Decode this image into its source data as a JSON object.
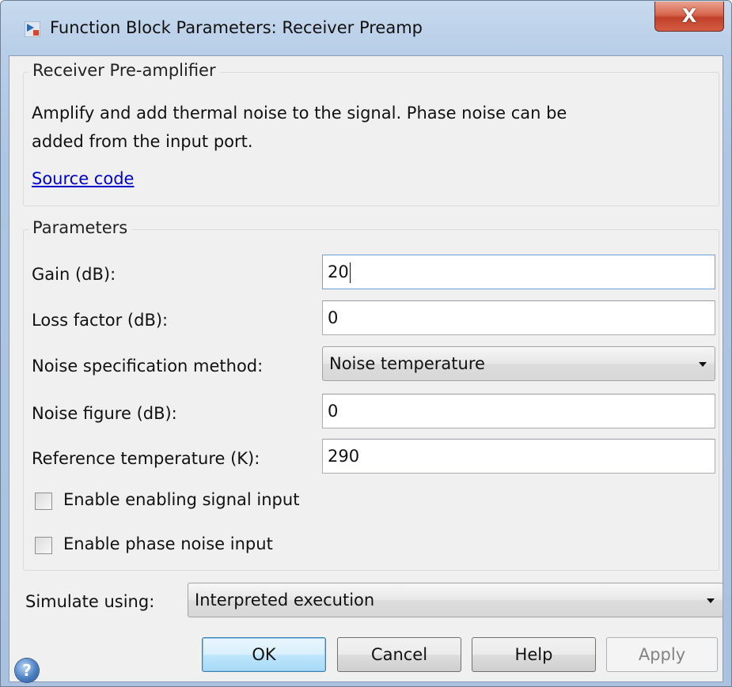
{
  "window": {
    "title": "Function Block Parameters: Receiver Preamp",
    "close_glyph": "X",
    "app_icon": "simulink-block-icon"
  },
  "description_group": {
    "title": "Receiver Pre-amplifier",
    "text_line1": "Amplify and add thermal noise to the signal. Phase noise can be",
    "text_line2": "added from the input port.",
    "link": "Source code"
  },
  "parameters_group": {
    "title": "Parameters",
    "gain": {
      "label": "Gain (dB):",
      "value": "20"
    },
    "loss_factor": {
      "label": "Loss factor (dB):",
      "value": "0"
    },
    "noise_method": {
      "label": "Noise specification method:",
      "value": "Noise temperature"
    },
    "noise_figure": {
      "label": "Noise figure (dB):",
      "value": "0"
    },
    "reference_temperature": {
      "label": "Reference temperature (K):",
      "value": "290"
    },
    "enable_signal_input": {
      "label": "Enable enabling signal input",
      "checked": false
    },
    "enable_phase_noise": {
      "label": "Enable phase noise input",
      "checked": false
    }
  },
  "simulate": {
    "label": "Simulate using:",
    "value": "Interpreted execution"
  },
  "buttons": {
    "help_icon": "?",
    "ok": "OK",
    "cancel": "Cancel",
    "help": "Help",
    "apply": "Apply"
  }
}
